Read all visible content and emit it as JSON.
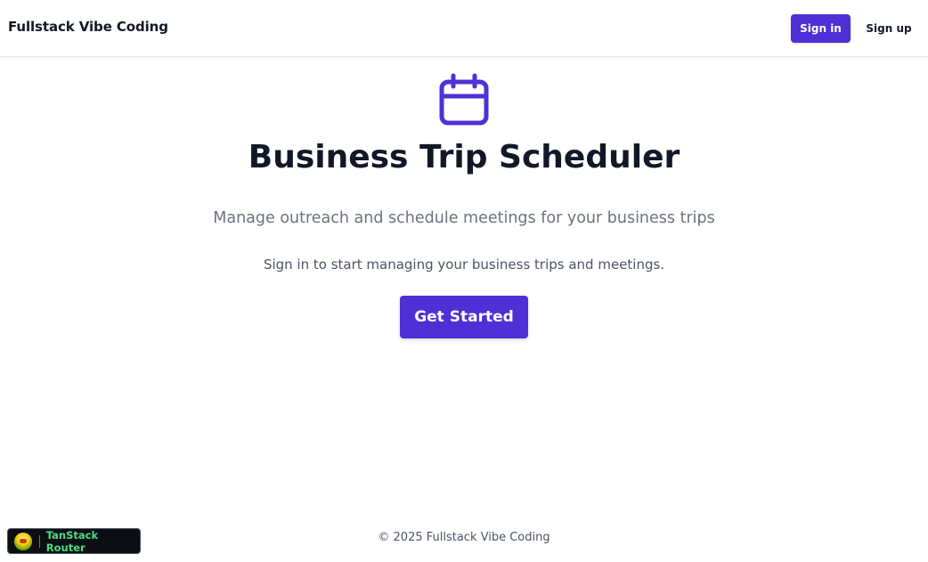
{
  "header": {
    "brand": "Fullstack Vibe Coding",
    "sign_in_label": "Sign in",
    "sign_up_label": "Sign up"
  },
  "hero": {
    "icon": "calendar-icon",
    "title": "Business Trip Scheduler",
    "subtitle": "Manage outreach and schedule meetings for your business trips",
    "hint": "Sign in to start managing your business trips and meetings.",
    "cta_label": "Get Started"
  },
  "footer": {
    "text": "© 2025 Fullstack Vibe Coding"
  },
  "devtools": {
    "icon": "tanstack-logo-icon",
    "label": "TanStack Router"
  },
  "colors": {
    "accent": "#4f2fd6",
    "devtools_label": "#4ade80"
  }
}
